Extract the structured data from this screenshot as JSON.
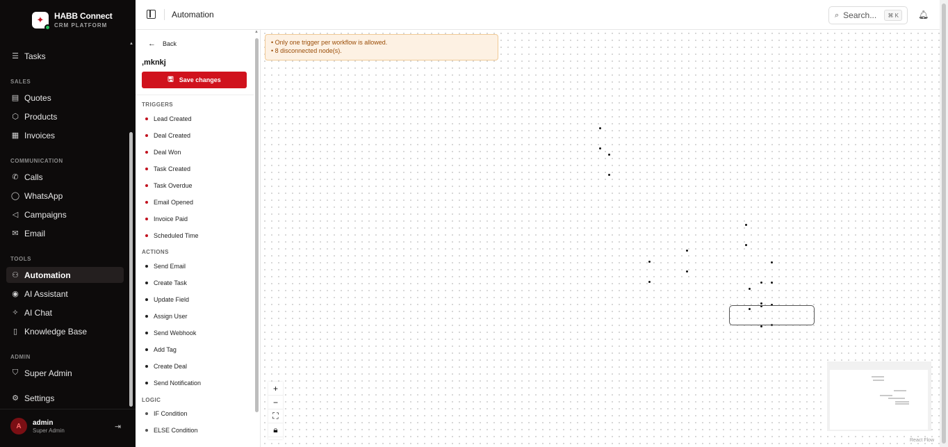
{
  "brand": {
    "name": "HABB Connect",
    "subtitle": "CRM PLATFORM"
  },
  "sidebar": {
    "items": [
      {
        "label": "Tasks",
        "icon": "list-check-icon"
      },
      {
        "section": "SALES"
      },
      {
        "label": "Quotes",
        "icon": "document-icon"
      },
      {
        "label": "Products",
        "icon": "box-icon"
      },
      {
        "label": "Invoices",
        "icon": "receipt-icon"
      },
      {
        "section": "COMMUNICATION"
      },
      {
        "label": "Calls",
        "icon": "phone-icon"
      },
      {
        "label": "WhatsApp",
        "icon": "chat-bubble-icon"
      },
      {
        "label": "Campaigns",
        "icon": "megaphone-icon"
      },
      {
        "label": "Email",
        "icon": "mail-icon"
      },
      {
        "section": "TOOLS"
      },
      {
        "label": "Automation",
        "icon": "workflow-icon",
        "active": true
      },
      {
        "label": "AI Assistant",
        "icon": "bot-icon"
      },
      {
        "label": "AI Chat",
        "icon": "sparkles-icon"
      },
      {
        "label": "Knowledge Base",
        "icon": "book-icon"
      },
      {
        "section": "ADMIN"
      },
      {
        "label": "Super Admin",
        "icon": "shield-icon"
      },
      {
        "label": "Settings",
        "icon": "gear-icon"
      }
    ],
    "sections": {
      "sales": "SALES",
      "communication": "COMMUNICATION",
      "tools": "TOOLS",
      "admin": "ADMIN"
    },
    "labels": {
      "tasks": "Tasks",
      "quotes": "Quotes",
      "products": "Products",
      "invoices": "Invoices",
      "calls": "Calls",
      "whatsapp": "WhatsApp",
      "campaigns": "Campaigns",
      "email": "Email",
      "automation": "Automation",
      "ai_assistant": "AI Assistant",
      "ai_chat": "AI Chat",
      "knowledge_base": "Knowledge Base",
      "super_admin": "Super Admin",
      "settings": "Settings"
    }
  },
  "user": {
    "initial": "A",
    "name": "admin",
    "role": "Super Admin"
  },
  "header": {
    "title": "Automation",
    "search_placeholder": "Search...",
    "search_shortcut": "⌘ K"
  },
  "palette": {
    "back_label": "Back",
    "workflow_name": ",mknkj",
    "save_label": "Save changes",
    "triggers_title": "TRIGGERS",
    "triggers": [
      "Lead Created",
      "Deal Created",
      "Deal Won",
      "Task Created",
      "Task Overdue",
      "Email Opened",
      "Invoice Paid",
      "Scheduled Time"
    ],
    "actions_title": "ACTIONS",
    "actions": [
      "Send Email",
      "Create Task",
      "Update Field",
      "Assign User",
      "Send Webhook",
      "Add Tag",
      "Create Deal",
      "Send Notification"
    ],
    "logic_title": "LOGIC",
    "logic": [
      "IF Condition",
      "ELSE Condition"
    ]
  },
  "canvas": {
    "warnings": [
      "• Only one trigger per workflow is allowed.",
      "• 8 disconnected node(s)."
    ],
    "attribution": "React Flow"
  },
  "colors": {
    "brand_red": "#d0121d",
    "sidebar_bg": "#0d0b0b",
    "warning_bg": "#fdf1e3",
    "warning_text": "#9a4d08",
    "online": "#22c55e"
  }
}
